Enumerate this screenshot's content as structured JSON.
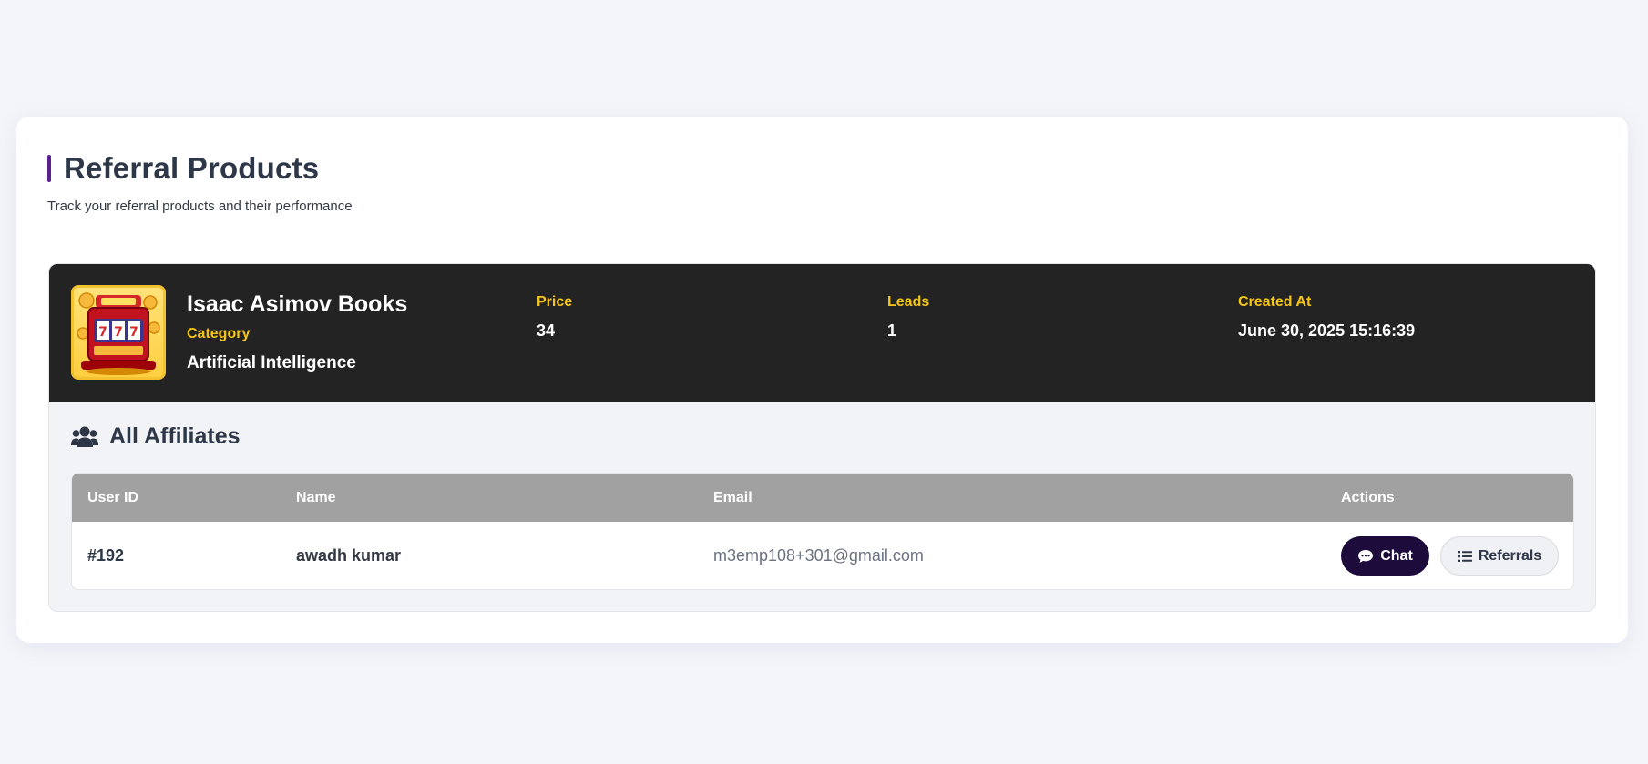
{
  "page": {
    "title": "Referral Products",
    "subtitle": "Track your referral products and their performance",
    "accent_color": "#5b1f8f"
  },
  "product": {
    "name": "Isaac Asimov Books",
    "image_icon": "slot-machine-image",
    "category_label": "Category",
    "category_value": "Artificial Intelligence",
    "stats": [
      {
        "label": "Price",
        "value": "34"
      },
      {
        "label": "Leads",
        "value": "1"
      },
      {
        "label": "Created At",
        "value": "June 30, 2025 15:16:39"
      }
    ],
    "header_bg": "#232323",
    "label_color": "#f5c518"
  },
  "affiliates": {
    "title": "All Affiliates",
    "icon": "users-icon",
    "columns": [
      "User ID",
      "Name",
      "Email",
      "Actions"
    ],
    "rows": [
      {
        "user_id": "#192",
        "name": "awadh kumar",
        "email": "m3emp108+301@gmail.com",
        "actions": {
          "chat": "Chat",
          "referrals": "Referrals"
        }
      }
    ]
  },
  "colors": {
    "chat_button": "#1c0b3b",
    "table_header": "#a1a1a1"
  }
}
